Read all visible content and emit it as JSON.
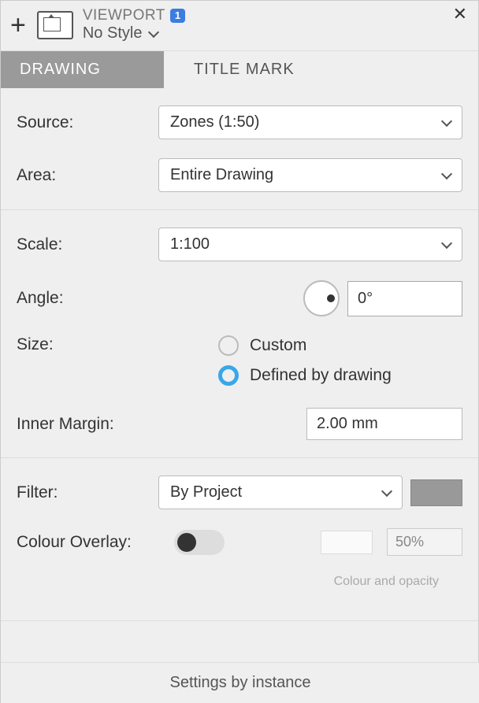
{
  "header": {
    "title": "VIEWPORT",
    "badge": "1",
    "style": "No Style"
  },
  "tabs": {
    "drawing": "DRAWING",
    "title_mark": "TITLE MARK"
  },
  "source": {
    "label": "Source:",
    "value": "Zones  (1:50)"
  },
  "area": {
    "label": "Area:",
    "value": "Entire Drawing"
  },
  "scale": {
    "label": "Scale:",
    "value": "1:100"
  },
  "angle": {
    "label": "Angle:",
    "value": "0°"
  },
  "size": {
    "label": "Size:",
    "custom": "Custom",
    "defined": "Defined by drawing"
  },
  "margin": {
    "label": "Inner Margin:",
    "value": "2.00 mm"
  },
  "filter": {
    "label": "Filter:",
    "value": "By Project"
  },
  "overlay": {
    "label": "Colour Overlay:",
    "opacity": "50%",
    "hint": "Colour and opacity"
  },
  "footer": "Settings by instance"
}
